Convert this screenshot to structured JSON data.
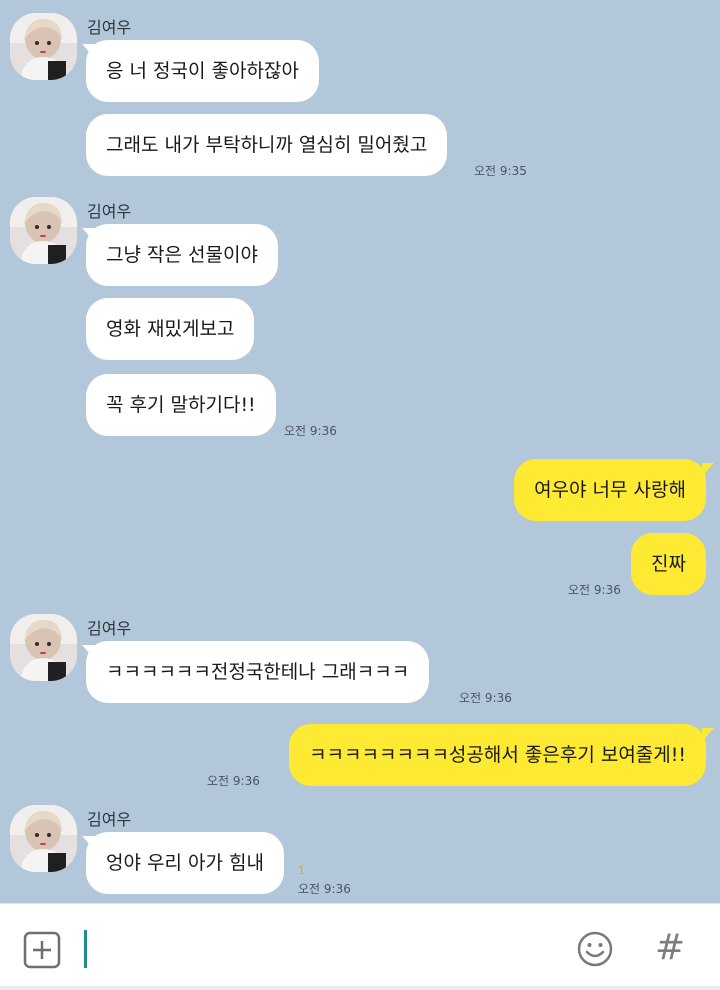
{
  "colors": {
    "background": "#b2c7da",
    "incoming_bubble": "#ffffff",
    "outgoing_bubble": "#fee933",
    "unread_count": "#d4b800",
    "cursor": "#1f8c87"
  },
  "messages": {
    "g1": {
      "sender": "김여우",
      "m1": "응 너 정국이 좋아하잖아",
      "m2": "그래도 내가 부탁하니까 열심히 밀어줬고",
      "time": "오전 9:35"
    },
    "g2": {
      "sender": "김여우",
      "m1": "그냥 작은 선물이야",
      "m2": "영화 재밌게보고",
      "m3": "꼭 후기 말하기다!!",
      "time": "오전 9:36"
    },
    "g3": {
      "m1": "여우야 너무 사랑해",
      "m2": "진짜",
      "time": "오전 9:36"
    },
    "g4": {
      "sender": "김여우",
      "m1": "ㅋㅋㅋㅋㅋㅋ전정국한테나 그래ㅋㅋㅋ",
      "time": "오전 9:36"
    },
    "g5": {
      "m1": "ㅋㅋㅋㅋㅋㅋㅋㅋ성공해서 좋은후기 보여줄게!!",
      "time": "오전 9:36"
    },
    "g6": {
      "sender": "김여우",
      "m1": "엉야 우리 아가 힘내",
      "unread": "1",
      "time": "오전 9:36"
    }
  },
  "inputbar": {
    "plus_icon": "plus-square-icon",
    "emoji_icon": "smiley-icon",
    "hash_label": "#"
  }
}
